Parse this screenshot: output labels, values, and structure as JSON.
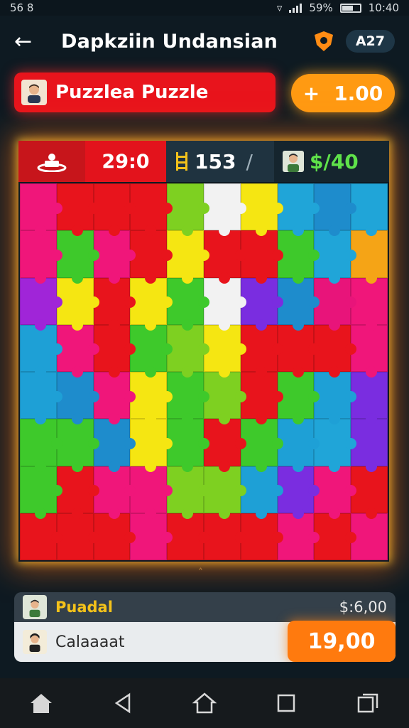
{
  "status": {
    "left": "56 8",
    "battery": "59%",
    "time": "10:40"
  },
  "header": {
    "title": "Dapkziin Undansian",
    "badge": "A27"
  },
  "banner": {
    "title": "Puzzlea Puzzle"
  },
  "coins": {
    "plus": "+",
    "value": "1.00"
  },
  "stats": {
    "score": "29:0",
    "moves": "153",
    "slash": "/",
    "money": "$/40"
  },
  "colors": {
    "accent_red": "#e3131c",
    "accent_orange": "#ff9a12",
    "money_green": "#5fe24a",
    "player_yellow": "#f4c21a"
  },
  "board": {
    "rows": [
      [
        "#f0167a",
        "#e8141c",
        "#e8141c",
        "#e8141c",
        "#7ed021",
        "#f2f2f2",
        "#f5e612",
        "#20a5d8",
        "#1e8ccc",
        "#20a5d8"
      ],
      [
        "#f0167a",
        "#3ec92b",
        "#f0167a",
        "#e8141c",
        "#f5e612",
        "#e8141c",
        "#e8141c",
        "#3ec92b",
        "#20a5d8",
        "#f5a416"
      ],
      [
        "#a025d8",
        "#f5e612",
        "#e8141c",
        "#f5e612",
        "#3ec92b",
        "#f2f2f2",
        "#7a2de0",
        "#1e8ccc",
        "#e8147a",
        "#f0167a"
      ],
      [
        "#1ea0d6",
        "#f0167a",
        "#e8141c",
        "#3ec92b",
        "#7ed021",
        "#f5e612",
        "#e8141c",
        "#e8141c",
        "#e8141c",
        "#f0167a"
      ],
      [
        "#1ea0d6",
        "#1e8ccc",
        "#f0167a",
        "#f5e612",
        "#3ec92b",
        "#7ed021",
        "#e8141c",
        "#3ec92b",
        "#1ea0d6",
        "#7a2de0"
      ],
      [
        "#3ec92b",
        "#3ec92b",
        "#1e8ccc",
        "#f5e612",
        "#3ec92b",
        "#e8141c",
        "#3ec92b",
        "#1ea0d6",
        "#20a5d8",
        "#7a2de0"
      ],
      [
        "#3ec92b",
        "#e8141c",
        "#f0167a",
        "#f0167a",
        "#7ed021",
        "#7ed021",
        "#1ea0d6",
        "#7a2de0",
        "#f0167a",
        "#e8141c"
      ],
      [
        "#e8141c",
        "#e8141c",
        "#e8141c",
        "#f0167a",
        "#e8141c",
        "#e8141c",
        "#e8141c",
        "#f0167a",
        "#e8141c",
        "#f0167a"
      ]
    ]
  },
  "players": [
    {
      "name": "Puadal",
      "amount": "$:6,00"
    },
    {
      "name": "Calaaaat",
      "bet": "19,00"
    }
  ],
  "nav": [
    "home-icon",
    "back-triangle-icon",
    "home-outline-icon",
    "square-icon",
    "recents-icon"
  ]
}
